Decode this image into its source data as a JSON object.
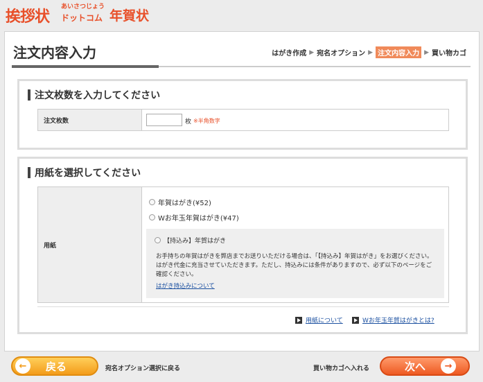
{
  "brand": {
    "logo_main": "挨拶状",
    "logo_small_top": "あいさつじょう",
    "logo_small_bottom": "ドットコム",
    "logo_sub": "年賀状"
  },
  "page": {
    "title": "注文内容入力",
    "steps": [
      {
        "label": "はがき作成",
        "active": false
      },
      {
        "label": "宛名オプション",
        "active": false
      },
      {
        "label": "注文内容入力",
        "active": true
      },
      {
        "label": "買い物カゴ",
        "active": false
      }
    ],
    "step_separator": "▶"
  },
  "quantity_section": {
    "heading": "注文枚数を入力してください",
    "row_label": "注文枚数",
    "input_value": "",
    "unit": "枚",
    "note": "※半角数字"
  },
  "paper_section": {
    "heading": "用紙を選択してください",
    "row_label": "用紙",
    "options": [
      {
        "label": "年賀はがき(¥52)"
      },
      {
        "label": "Wお年玉年賀はがき(¥47)"
      }
    ],
    "bring_option": {
      "label": "【持込み】年賀はがき",
      "text": "お手持ちの年賀はがきを弊店までお送りいただける場合は、「【持込み】年賀はがき」をお選びください。はがき代金に充当させていただきます。ただし、持込みには条件がありますので、必ず以下のページをご確認ください。",
      "link": "はがき持込みについて"
    },
    "links": [
      {
        "label": "用紙について"
      },
      {
        "label": "Wお年玉年賀はがきとは?"
      }
    ]
  },
  "footer": {
    "back_button": "戻る",
    "back_text": "宛名オプション選択に戻る",
    "cart_text": "買い物カゴへ入れる",
    "next_button": "次へ"
  }
}
